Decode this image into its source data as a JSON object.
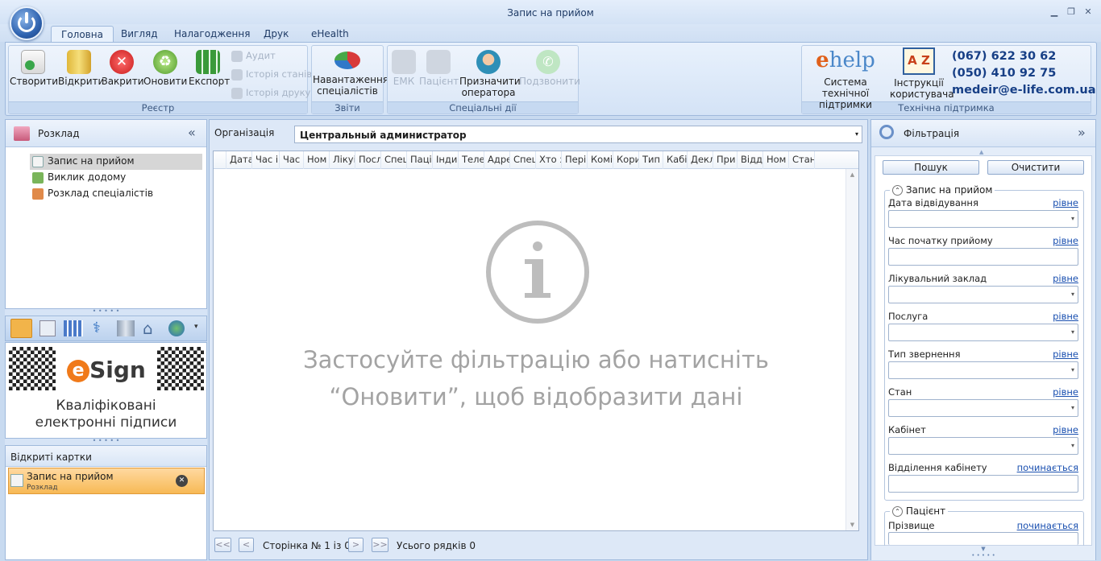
{
  "window": {
    "title": "Запис на прийом"
  },
  "tabs": [
    {
      "label": "Головна",
      "active": true
    },
    {
      "label": "Вигляд"
    },
    {
      "label": "Налагодження"
    },
    {
      "label": "Друк"
    },
    {
      "label": "eHealth"
    }
  ],
  "ribbon": {
    "registry": {
      "caption": "Реєстр",
      "buttons": [
        "Створити",
        "Відкрити",
        "Закрити",
        "Оновити",
        "Експорт"
      ],
      "small": [
        "Аудит",
        "Історія станів",
        "Історія друку"
      ]
    },
    "reports": {
      "caption": "Звіти",
      "button_line1": "Навантаження",
      "button_line2": "спеціалістів"
    },
    "special": {
      "caption": "Спеціальні дії",
      "buttons": [
        {
          "label": "ЕМК",
          "disabled": true
        },
        {
          "label": "Пацієнт",
          "disabled": true
        },
        {
          "label1": "Призначити",
          "label2": "оператора"
        },
        {
          "label": "Подзвонити",
          "disabled": true
        }
      ]
    },
    "support": {
      "caption": "Технічна підтримка",
      "logo": "help",
      "logo_e": "e",
      "help_line1": "Система технічної",
      "help_line2": "підтримки",
      "instr_line1": "Інструкції",
      "instr_line2": "користувача",
      "az": "A Z",
      "phone1": "(067) 622 30 62",
      "phone2": "(050) 410 92 75",
      "email": "medeir@e-life.com.ua"
    }
  },
  "left": {
    "header": "Розклад",
    "collapse": "«",
    "tree": [
      "Запис на прийом",
      "Виклик додому",
      "Розклад спеціалістів"
    ],
    "esign": {
      "brand_e": "e",
      "brand_rest": "Sign",
      "line1": "Кваліфіковані",
      "line2": "електронні підписи"
    },
    "open_cards": {
      "header": "Відкриті картки",
      "card_title": "Запис на прийом",
      "card_sub": "Розклад"
    }
  },
  "main": {
    "org_label": "Організація",
    "org_value": "Центральный администратор",
    "columns": [
      "Дата",
      "Час і",
      "Час :",
      "Ном",
      "Лікуі",
      "Посл",
      "Спец",
      "Паці",
      "Інди",
      "Теле",
      "Адре",
      "Спец",
      "Хто з",
      "Пері",
      "Комі",
      "Кори",
      "Тип",
      "Кабі",
      "Декл",
      "При",
      "Відд",
      "Ном",
      "Стан"
    ],
    "empty_line1": "Застосуйте фільтрацію або натисніть",
    "empty_line2": "“Оновити”, щоб відобразити дані",
    "pager": {
      "first": "<<",
      "prev": "<",
      "page_text": "Сторінка № 1 із 0",
      "next": ">",
      "last": ">>",
      "total": "Усього рядків 0"
    }
  },
  "filter": {
    "header": "Фільтрація",
    "expand": "»",
    "search": "Пошук",
    "clear": "Очистити",
    "section1": "Запис на прийом",
    "fields": [
      {
        "label": "Дата відвідування",
        "op": "рівне",
        "combo": true
      },
      {
        "label": "Час початку прийому",
        "op": "рівне",
        "combo": false
      },
      {
        "label": "Лікувальний заклад",
        "op": "рівне",
        "combo": true
      },
      {
        "label": "Послуга",
        "op": "рівне",
        "combo": true
      },
      {
        "label": "Тип звернення",
        "op": "рівне",
        "combo": true
      },
      {
        "label": "Стан",
        "op": "рівне",
        "combo": true
      },
      {
        "label": "Кабінет",
        "op": "рівне",
        "combo": true
      },
      {
        "label": "Відділення кабінету",
        "op": "починається",
        "combo": false
      }
    ],
    "section2": "Пацієнт",
    "patient_field": {
      "label": "Прізвище",
      "op": "починається"
    }
  }
}
